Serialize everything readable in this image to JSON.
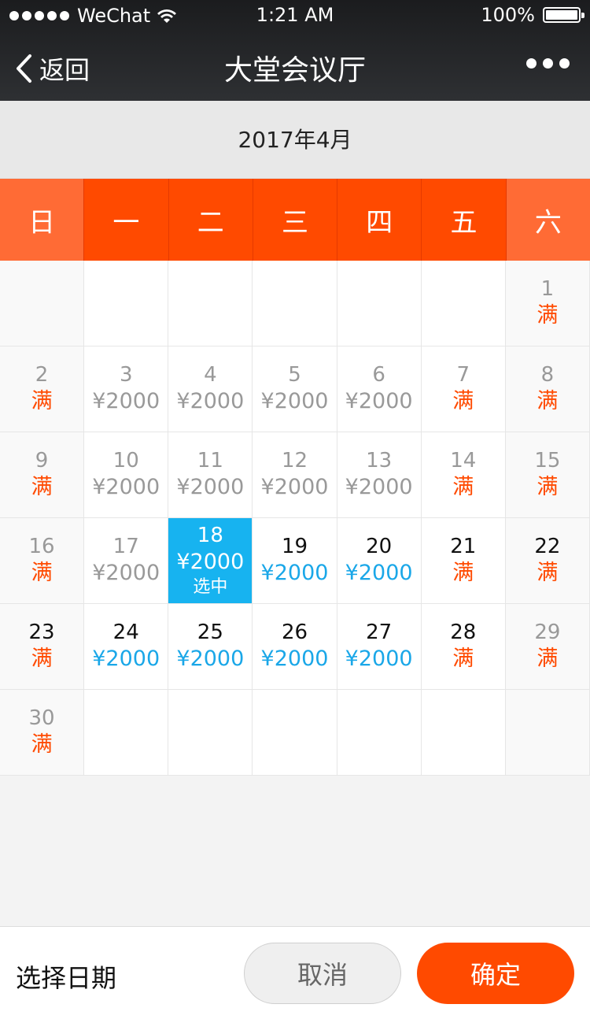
{
  "status_bar": {
    "carrier": "WeChat",
    "time": "1:21 AM",
    "battery": "100%"
  },
  "nav": {
    "back_label": "返回",
    "title": "大堂会议厅"
  },
  "calendar": {
    "month_label": "2017年4月",
    "weekdays": [
      "日",
      "一",
      "二",
      "三",
      "四",
      "五",
      "六"
    ],
    "weeks": [
      [
        {},
        {},
        {},
        {},
        {},
        {},
        {
          "day": "1",
          "sub": "满",
          "state": "past",
          "full": true
        }
      ],
      [
        {
          "day": "2",
          "sub": "满",
          "state": "past",
          "full": true
        },
        {
          "day": "3",
          "sub": "¥2000",
          "state": "past"
        },
        {
          "day": "4",
          "sub": "¥2000",
          "state": "past"
        },
        {
          "day": "5",
          "sub": "¥2000",
          "state": "past"
        },
        {
          "day": "6",
          "sub": "¥2000",
          "state": "past"
        },
        {
          "day": "7",
          "sub": "满",
          "state": "past",
          "full": true
        },
        {
          "day": "8",
          "sub": "满",
          "state": "past",
          "full": true
        }
      ],
      [
        {
          "day": "9",
          "sub": "满",
          "state": "past",
          "full": true
        },
        {
          "day": "10",
          "sub": "¥2000",
          "state": "past"
        },
        {
          "day": "11",
          "sub": "¥2000",
          "state": "past"
        },
        {
          "day": "12",
          "sub": "¥2000",
          "state": "past"
        },
        {
          "day": "13",
          "sub": "¥2000",
          "state": "past"
        },
        {
          "day": "14",
          "sub": "满",
          "state": "past",
          "full": true
        },
        {
          "day": "15",
          "sub": "满",
          "state": "past",
          "full": true
        }
      ],
      [
        {
          "day": "16",
          "sub": "满",
          "state": "past",
          "full": true
        },
        {
          "day": "17",
          "sub": "¥2000",
          "state": "past"
        },
        {
          "day": "18",
          "sub": "¥2000",
          "state": "selected",
          "tag": "选中"
        },
        {
          "day": "19",
          "sub": "¥2000",
          "state": "avail"
        },
        {
          "day": "20",
          "sub": "¥2000",
          "state": "avail"
        },
        {
          "day": "21",
          "sub": "满",
          "state": "avail",
          "full": true
        },
        {
          "day": "22",
          "sub": "满",
          "state": "avail",
          "full": true
        }
      ],
      [
        {
          "day": "23",
          "sub": "满",
          "state": "avail",
          "full": true
        },
        {
          "day": "24",
          "sub": "¥2000",
          "state": "avail"
        },
        {
          "day": "25",
          "sub": "¥2000",
          "state": "avail"
        },
        {
          "day": "26",
          "sub": "¥2000",
          "state": "avail"
        },
        {
          "day": "27",
          "sub": "¥2000",
          "state": "avail"
        },
        {
          "day": "28",
          "sub": "满",
          "state": "avail",
          "full": true
        },
        {
          "day": "29",
          "sub": "满",
          "state": "past",
          "full": true
        }
      ],
      [
        {
          "day": "30",
          "sub": "满",
          "state": "past",
          "full": true
        },
        {},
        {},
        {},
        {},
        {},
        {}
      ]
    ]
  },
  "footer": {
    "label": "选择日期",
    "cancel_label": "取消",
    "confirm_label": "确定"
  },
  "colors": {
    "accent": "#ff4a00",
    "weekend_header": "#ff6b35",
    "selected": "#17b3f0",
    "price": "#1aa7e8"
  }
}
